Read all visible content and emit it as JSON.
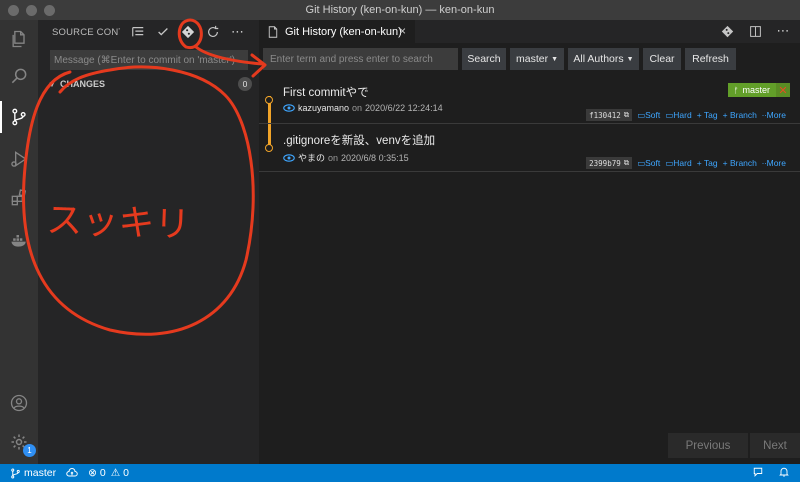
{
  "window": {
    "title": "Git History (ken-on-kun) — ken-on-kun"
  },
  "activity_bar": {
    "items": [
      "explorer",
      "search",
      "source-control",
      "run-debug",
      "extensions",
      "docker"
    ],
    "bottom": [
      "account",
      "settings"
    ],
    "settings_badge": "1"
  },
  "sidebar": {
    "title": "SOURCE CONT...",
    "message_placeholder": "Message (⌘Enter to commit on 'master')",
    "changes_label": "CHANGES",
    "changes_count": "0"
  },
  "tab": {
    "label": "Git History (ken-on-kun)",
    "close": "×"
  },
  "toolbar": {
    "search_placeholder": "Enter term and press enter to search",
    "search_button": "Search",
    "branch_select": "master",
    "author_select": "All Authors",
    "clear_button": "Clear",
    "refresh_button": "Refresh"
  },
  "commits": [
    {
      "subject": "First commitやで",
      "author": "kazuyamano",
      "on": "on",
      "date": "2020/6/22 12:24:14",
      "hash": "f130412",
      "branch_tag": "master",
      "actions": {
        "soft": "Soft",
        "hard": "Hard",
        "tag": "+ Tag",
        "branch": "+ Branch",
        "more": "More"
      }
    },
    {
      "subject": ".gitignoreを新設、venvを追加",
      "author": "やまの",
      "on": "on",
      "date": "2020/6/8 0:35:15",
      "hash": "2399b79",
      "actions": {
        "soft": "Soft",
        "hard": "Hard",
        "tag": "+ Tag",
        "branch": "+ Branch",
        "more": "More"
      }
    }
  ],
  "pager": {
    "previous": "Previous",
    "next": "Next"
  },
  "statusbar": {
    "branch": "master",
    "errors": "0",
    "warnings": "0"
  },
  "annotation": {
    "text": "スッキリ",
    "color": "#e53a1e"
  },
  "colors": {
    "accent": "#007acc",
    "graph": "#f1a429",
    "link": "#3ea6ff",
    "branch_tag": "#629f29"
  }
}
